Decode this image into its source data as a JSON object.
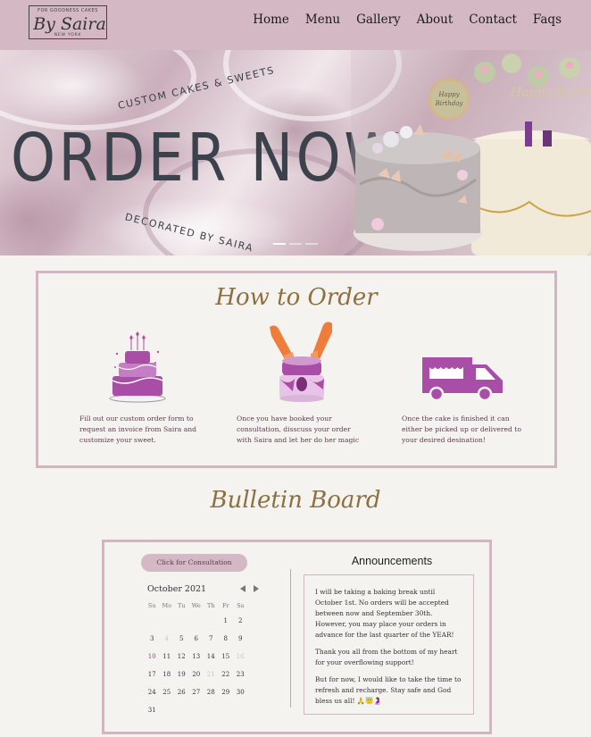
{
  "nav": {
    "logo": {
      "top": "FOR GOODNESS CAKES",
      "main": "By Saira",
      "bottom": "NEW YORK"
    },
    "links": [
      "Home",
      "Menu",
      "Gallery",
      "About",
      "Contact",
      "Faqs"
    ]
  },
  "hero": {
    "arc_top": "CUSTOM CAKES & SWEETS",
    "title": "ORDER NOW",
    "arc_bottom": "DECORATED BY SAIRA",
    "topper_text": "Happy Birthday",
    "slide_count": 3
  },
  "how_to_order": {
    "title": "How to Order",
    "steps": [
      {
        "icon": "tiered-cake-icon",
        "text": "Fill out our custom order form to request an invoice from Saira and customize your sweet."
      },
      {
        "icon": "hands-cake-icon",
        "text": "Once you have booked your consultation, disscuss your order with Saira and let her do her magic"
      },
      {
        "icon": "delivery-van-icon",
        "text": "Once the cake is finished it can either be picked up or delivered to your desired desination!"
      }
    ]
  },
  "bulletin": {
    "title": "Bulletin Board",
    "consult_button": "Click for Consultation",
    "calendar": {
      "month": "October 2021",
      "weekdays": [
        "Su",
        "Mo",
        "Tu",
        "We",
        "Th",
        "Fr",
        "Sa"
      ],
      "weeks": [
        [
          "",
          "",
          "",
          "",
          "",
          "1",
          "2"
        ],
        [
          "3",
          "4",
          "5",
          "6",
          "7",
          "8",
          "9"
        ],
        [
          "10",
          "11",
          "12",
          "13",
          "14",
          "15",
          "16"
        ],
        [
          "17",
          "18",
          "19",
          "20",
          "21",
          "22",
          "23"
        ],
        [
          "24",
          "25",
          "26",
          "27",
          "28",
          "29",
          "30"
        ],
        [
          "31",
          "",
          "",
          "",
          "",
          "",
          ""
        ]
      ],
      "faded_days": [
        "4",
        "16",
        "21"
      ],
      "highlight_day": "10"
    },
    "announcements": {
      "title": "Announcements",
      "paragraphs": [
        "I will be taking a baking break until October 1st. No orders will be accepted between now and September 30th. However, you may place your orders in advance for the last quarter of the YEAR!",
        "Thank you all from the bottom of my heart for your overflowing support!",
        "But for now, I would like to take the time to refresh and recharge. Stay safe and God bless us all! 🙏😇🤰"
      ]
    }
  },
  "colors": {
    "nav_bg": "#d4b9c4",
    "accent_gold": "#8e6f3f",
    "icon_purple": "#a94ea6",
    "page_bg": "#f5f3ef"
  }
}
